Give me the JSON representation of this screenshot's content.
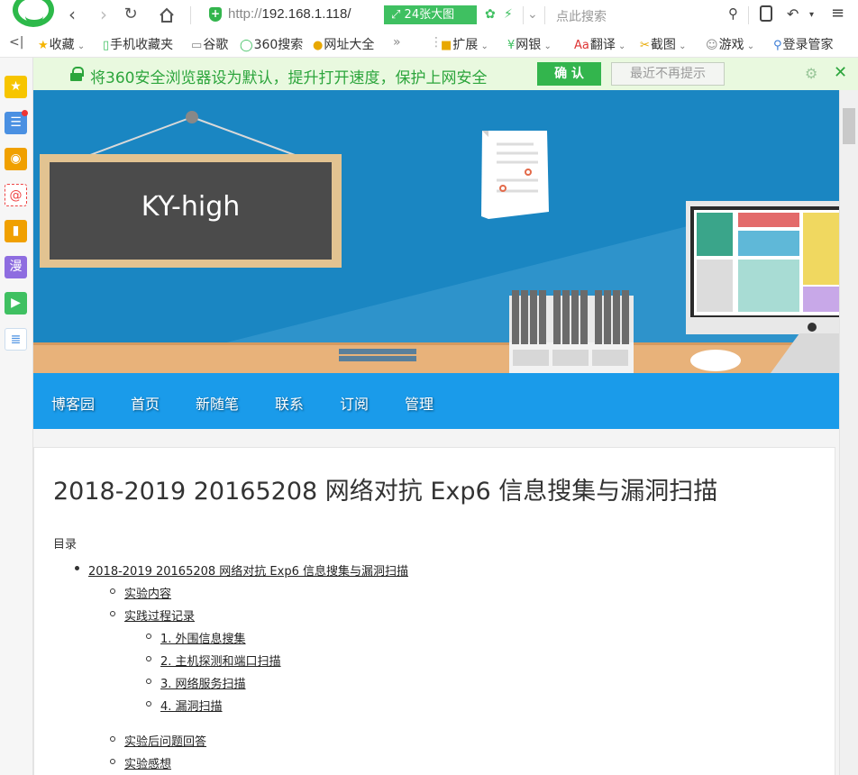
{
  "toolbar": {
    "url_scheme": "http://",
    "url_host": "192.168.1.118/",
    "big_image_label": "24张大图",
    "search_placeholder": "点此搜索"
  },
  "bookmarks": {
    "toggle": "<|",
    "items": [
      "收藏",
      "手机收藏夹",
      "谷歌",
      "360搜索",
      "网址大全"
    ],
    "more": "»",
    "right_items": [
      "扩展",
      "网银",
      "翻译",
      "截图",
      "游戏",
      "登录管家"
    ]
  },
  "notice": {
    "text": "将360安全浏览器设为默认，提升打开速度，保护上网安全",
    "ok_label": "确 认",
    "dismiss_label": "最近不再提示"
  },
  "banner": {
    "board_text": "KY-high"
  },
  "blog_nav": {
    "items": [
      "博客园",
      "首页",
      "新随笔",
      "联系",
      "订阅",
      "管理"
    ]
  },
  "post": {
    "title": "2018-2019 20165208 网络对抗 Exp6 信息搜集与漏洞扫描",
    "toc_label": "目录",
    "toc": {
      "main": "2018-2019 20165208 网络对抗 Exp6 信息搜集与漏洞扫描",
      "sub1": "实验内容",
      "sub2": "实践过程记录",
      "sub2_children": [
        "1. 外围信息搜集",
        "2. 主机探测和端口扫描",
        "3. 网络服务扫描",
        "4. 漏洞扫描"
      ],
      "sub3": "实验后问题回答",
      "sub4": "实验感想"
    }
  },
  "colors": {
    "accent_green": "#33b54d",
    "banner_blue": "#1a86c2",
    "nav_blue": "#1a9bea"
  }
}
